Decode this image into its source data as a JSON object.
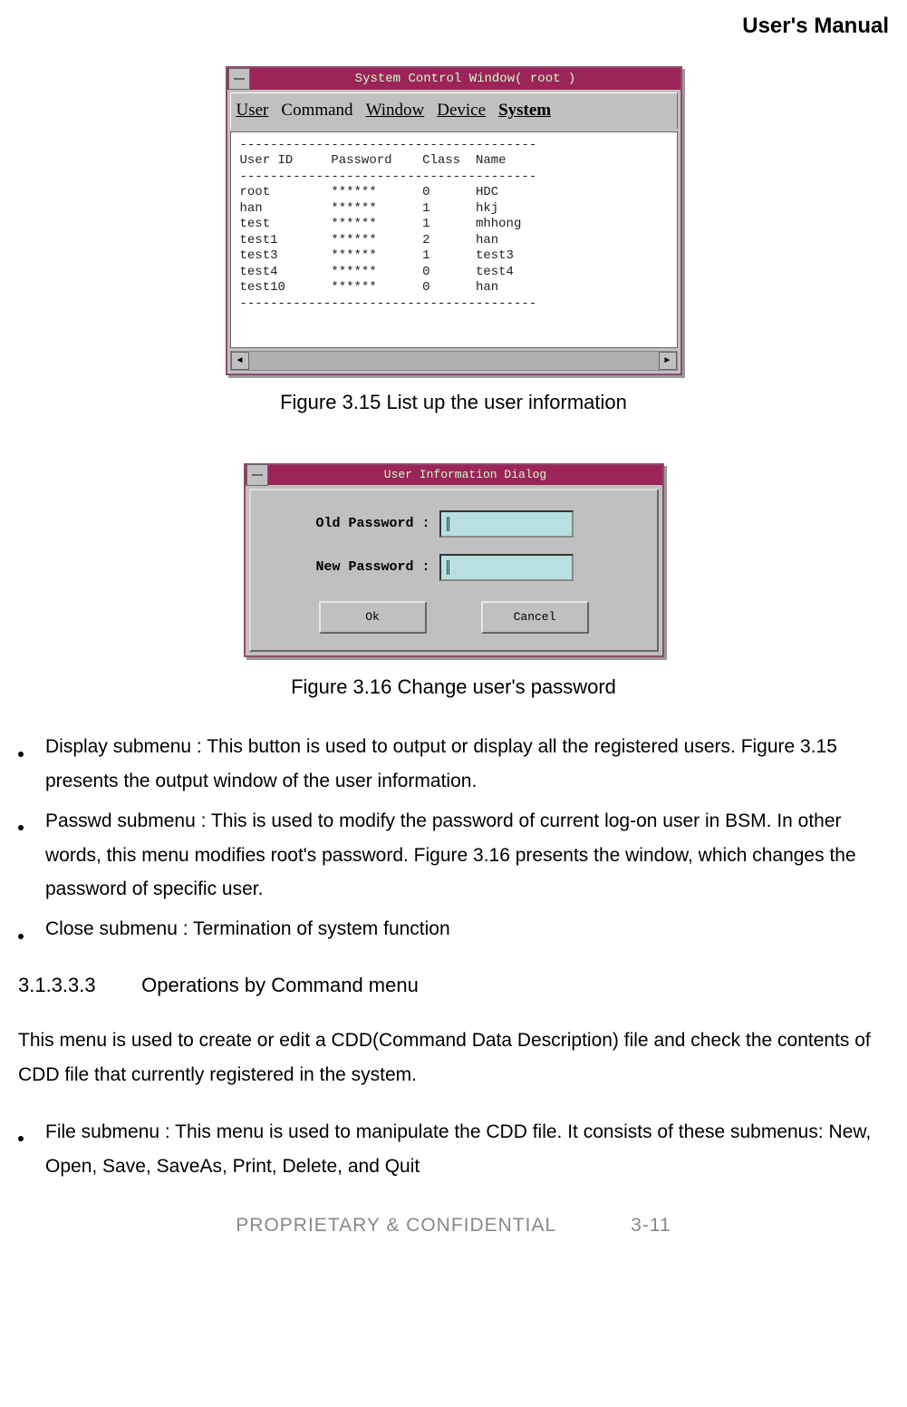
{
  "header": {
    "title": "User's Manual"
  },
  "fig1": {
    "window_title": "System Control Window( root )",
    "menu": [
      "User",
      "Command",
      "Window",
      "Device",
      "System"
    ],
    "columns_line": "User ID     Password    Class  Name",
    "sep": "---------------------------------------",
    "rows": [
      "root        ******      0      HDC",
      "han         ******      1      hkj",
      "test        ******      1      mhhong",
      "test1       ******      2      han",
      "test3       ******      1      test3",
      "test4       ******      0      test4",
      "test10      ******      0      han"
    ],
    "caption": "Figure 3.15 List up the user information"
  },
  "fig2": {
    "dialog_title": "User Information Dialog",
    "old_label": "Old Password :",
    "new_label": "New Password :",
    "ok_label": "Ok",
    "cancel_label": "Cancel",
    "caption": "Figure 3.16 Change user's password"
  },
  "bullets1": [
    "Display submenu :  This button is used to output or display all the registered users. Figure 3.15 presents the output window of the user information.",
    "Passwd submenu : This is used to modify the password of current log-on user in BSM. In other words, this menu modifies root's password. Figure 3.16 presents the window, which changes the password of specific user.",
    "Close submenu : Termination of system function"
  ],
  "section": {
    "number": "3.1.3.3.3",
    "title": "Operations by Command menu"
  },
  "para1": "This menu is used to create or edit a CDD(Command Data Description) file and check the contents of CDD file that currently registered in the system.",
  "bullets2": [
    "File submenu : This menu is used to manipulate the CDD file. It consists of these submenus: New, Open, Save, SaveAs, Print, Delete, and Quit"
  ],
  "footer": {
    "left": "PROPRIETARY & CONFIDENTIAL",
    "right": "3-11"
  }
}
